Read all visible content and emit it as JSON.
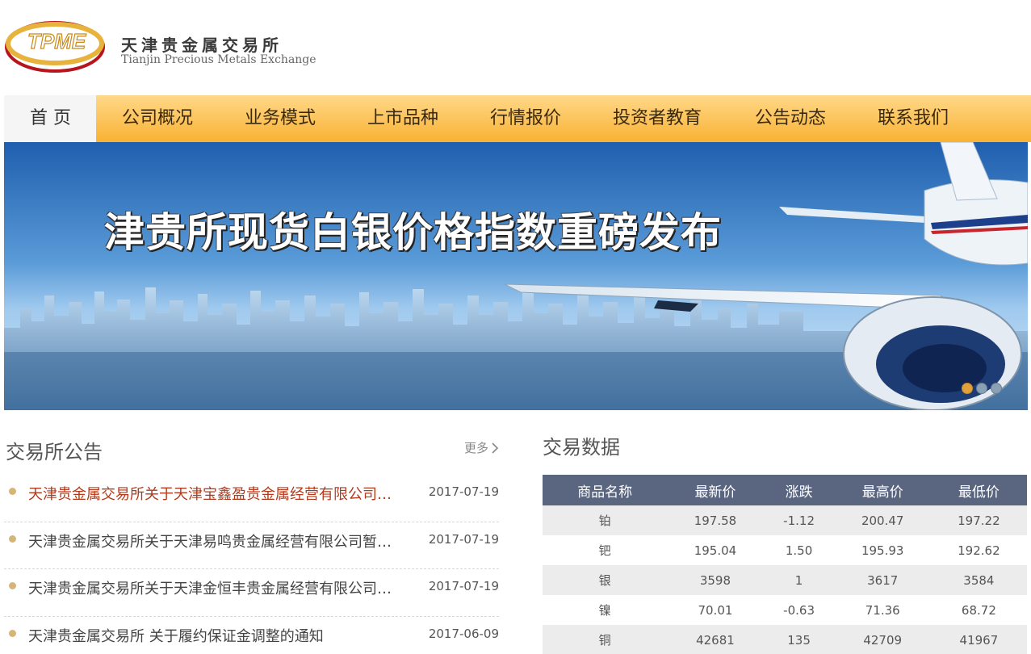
{
  "brand": {
    "logo_text": "TPME",
    "name_cn": "天津贵金属交易所",
    "name_en": "Tianjin Precious Metals Exchange"
  },
  "nav": {
    "items": [
      {
        "label": "首 页",
        "active": true
      },
      {
        "label": "公司概况"
      },
      {
        "label": "业务模式"
      },
      {
        "label": "上市品种"
      },
      {
        "label": "行情报价"
      },
      {
        "label": "投资者教育"
      },
      {
        "label": "公告动态"
      },
      {
        "label": "联系我们"
      }
    ]
  },
  "banner": {
    "title": "津贵所现货白银价格指数重磅发布",
    "slide_count": 3,
    "active_slide": 1
  },
  "announcements": {
    "title": "交易所公告",
    "more_label": "更多",
    "items": [
      {
        "text": "天津贵金属交易所关于天津宝鑫盈贵金属经营有限公司暂..",
        "date": "2017-07-19"
      },
      {
        "text": "天津贵金属交易所关于天津易鸣贵金属经营有限公司暂停..",
        "date": "2017-07-19"
      },
      {
        "text": "天津贵金属交易所关于天津金恒丰贵金属经营有限公司暂..",
        "date": "2017-07-19"
      },
      {
        "text": "天津贵金属交易所 关于履约保证金调整的通知",
        "date": "2017-06-09"
      }
    ]
  },
  "trading": {
    "title": "交易数据",
    "headers": [
      "商品名称",
      "最新价",
      "涨跌",
      "最高价",
      "最低价"
    ],
    "rows": [
      [
        "铂",
        "197.58",
        "-1.12",
        "200.47",
        "197.22"
      ],
      [
        "钯",
        "195.04",
        "1.50",
        "195.93",
        "192.62"
      ],
      [
        "银",
        "3598",
        "1",
        "3617",
        "3584"
      ],
      [
        "镍",
        "70.01",
        "-0.63",
        "71.36",
        "68.72"
      ],
      [
        "铜",
        "42681",
        "135",
        "42709",
        "41967"
      ]
    ]
  },
  "colors": {
    "nav_gold": "#f9b233",
    "announcement_red": "#b23a1c",
    "table_header": "#5a6580"
  }
}
